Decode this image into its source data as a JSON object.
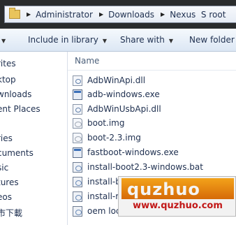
{
  "address_bar": {
    "crumbs": [
      "Administrator",
      "Downloads",
      "Nexus  S root"
    ]
  },
  "toolbar": {
    "include_in_library": "Include in library",
    "share_with": "Share with",
    "new_folder": "New folder"
  },
  "nav": {
    "items": [
      "rites",
      "ktop",
      "wnloads",
      "ent Places",
      "ries",
      "cuments",
      "sic",
      "tures",
      "eos",
      "市下載"
    ]
  },
  "list": {
    "column_name": "Name",
    "files": [
      {
        "name": "AdbWinApi.dll",
        "icon": "dll-file-icon"
      },
      {
        "name": "adb-windows.exe",
        "icon": "exe-file-icon"
      },
      {
        "name": "AdbWinUsbApi.dll",
        "icon": "dll-file-icon"
      },
      {
        "name": "boot.img",
        "icon": "img-file-icon"
      },
      {
        "name": "boot-2.3.img",
        "icon": "img-file-icon"
      },
      {
        "name": "fastboot-windows.exe",
        "icon": "exe-file-icon"
      },
      {
        "name": "install-boot2.3-windows.bat",
        "icon": "bat-file-icon"
      },
      {
        "name": "install-b",
        "icon": "bat-file-icon"
      },
      {
        "name": "install-r",
        "icon": "bat-file-icon"
      },
      {
        "name": "oem loc",
        "icon": "bat-file-icon"
      }
    ]
  },
  "watermark": {
    "logo": "quzhuo",
    "url": "www.quzhuo.com"
  }
}
